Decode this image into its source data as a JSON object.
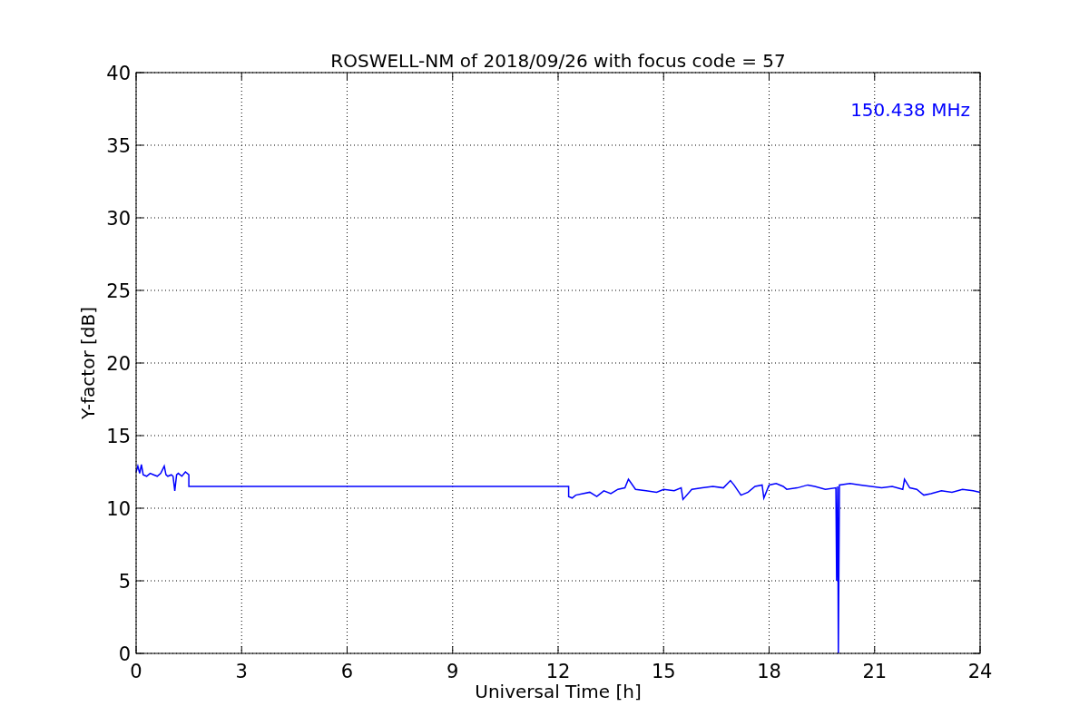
{
  "chart_data": {
    "type": "line",
    "title": "ROSWELL-NM of 2018/09/26 with focus code = 57",
    "xlabel": "Universal Time [h]",
    "ylabel": "Y-factor [dB]",
    "x": [
      0,
      0.05,
      0.1,
      0.15,
      0.2,
      0.3,
      0.4,
      0.5,
      0.6,
      0.7,
      0.8,
      0.85,
      0.9,
      1.0,
      1.05,
      1.1,
      1.15,
      1.2,
      1.3,
      1.4,
      1.5,
      1.5,
      12.3,
      12.3,
      12.4,
      12.5,
      12.7,
      12.9,
      13.1,
      13.3,
      13.5,
      13.7,
      13.9,
      14.0,
      14.2,
      14.5,
      14.8,
      15.0,
      15.3,
      15.5,
      15.55,
      15.8,
      16.1,
      16.4,
      16.7,
      16.9,
      17.0,
      17.2,
      17.4,
      17.6,
      17.8,
      17.85,
      18.0,
      18.2,
      18.4,
      18.5,
      18.8,
      19.1,
      19.3,
      19.6,
      19.9,
      19.92,
      19.95,
      19.97,
      20.0,
      20.3,
      20.6,
      20.9,
      21.2,
      21.5,
      21.8,
      21.85,
      22.0,
      22.2,
      22.4,
      22.6,
      22.9,
      23.2,
      23.5,
      23.8,
      24.0
    ],
    "series": [
      {
        "color": "#0000ff",
        "values": [
          12.5,
          12.9,
          12.4,
          13.0,
          12.3,
          12.2,
          12.4,
          12.3,
          12.2,
          12.4,
          12.9,
          12.3,
          12.2,
          12.3,
          12.2,
          11.2,
          12.3,
          12.4,
          12.2,
          12.5,
          12.3,
          11.5,
          11.5,
          10.8,
          10.7,
          10.9,
          11.0,
          11.1,
          10.8,
          11.2,
          11.0,
          11.3,
          11.4,
          12.0,
          11.3,
          11.2,
          11.1,
          11.3,
          11.2,
          11.4,
          10.6,
          11.3,
          11.4,
          11.5,
          11.4,
          11.9,
          11.6,
          10.9,
          11.1,
          11.5,
          11.6,
          10.7,
          11.6,
          11.7,
          11.5,
          11.3,
          11.4,
          11.6,
          11.5,
          11.3,
          11.4,
          5.0,
          11.5,
          0,
          11.6,
          11.7,
          11.6,
          11.5,
          11.4,
          11.5,
          11.3,
          12.0,
          11.4,
          11.3,
          10.9,
          11.0,
          11.2,
          11.1,
          11.3,
          11.2,
          11.1
        ]
      }
    ],
    "xlim": [
      0,
      24
    ],
    "ylim": [
      0,
      40
    ],
    "xticks": [
      0,
      3,
      6,
      9,
      12,
      15,
      18,
      21,
      24
    ],
    "yticks": [
      0,
      5,
      10,
      15,
      20,
      25,
      30,
      35,
      40
    ],
    "grid": true,
    "annotations": [
      {
        "text": "150.438 MHz"
      }
    ]
  }
}
